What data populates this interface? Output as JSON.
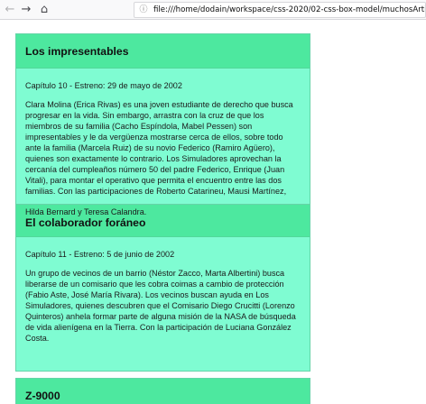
{
  "browser": {
    "back_icon": "back-arrow-icon",
    "forward_icon": "forward-arrow-icon",
    "home_icon": "home-icon",
    "info_icon": "info-icon",
    "url": "file:///home/dodain/workspace/css-2020/02-css-box-model/muchosArticulos.html"
  },
  "articles": [
    {
      "title": "Los impresentables",
      "subtitle": "Capítulo 10 - Estreno: 29 de mayo de 2002",
      "text": "Clara Molina (Erica Rivas) es una joven estudiante de derecho que busca progresar en la vida. Sin embargo, arrastra con la cruz de que los miembros de su familia (Cacho Espíndola, Mabel Pessen) son impresentables y le da vergüenza mostrarse cerca de ellos, sobre todo ante la familia (Marcela Ruiz) de su novio Federico (Ramiro Agüero), quienes son exactamente lo contrario. Los Simuladores aprovechan la cercanía del cumpleaños número 50 del padre Federico, Enrique (Juan Vitali), para montar el operativo que permita el encuentro entre las dos familias. Con las participaciones de Roberto Catarineu, Mausi Martínez,",
      "overflow": "Hilda Bernard y Teresa Calandra."
    },
    {
      "title": "El colaborador foráneo",
      "subtitle": "Capítulo 11 - Estreno: 5 de junio de 2002",
      "text": "Un grupo de vecinos de un barrio (Néstor Zacco, Marta Albertini) busca liberarse de un comisario que les cobra coimas a cambio de protección (Fabio Aste, José María Rivara). Los vecinos buscan ayuda en Los Simuladores, quienes descubren que el Comisario Diego Crucitti (Lorenzo Quinteros) anhela formar parte de alguna misión de la NASA de búsqueda de vida alienígena en la Tierra. Con la participación de Luciana González Costa."
    },
    {
      "title": "Z-9000"
    }
  ]
}
